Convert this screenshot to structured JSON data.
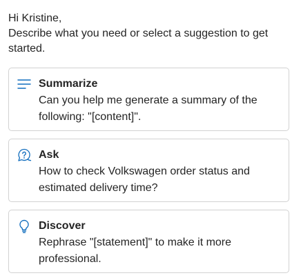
{
  "greeting": {
    "line1": "Hi Kristine,",
    "line2": "Describe what you need or select a suggestion to get started."
  },
  "suggestions": [
    {
      "icon": "text-lines-icon",
      "title": "Summarize",
      "description": "Can you help me generate a summary of the following: \"[content]\"."
    },
    {
      "icon": "chat-question-icon",
      "title": "Ask",
      "description": "How to check Volkswagen order status and estimated delivery time?"
    },
    {
      "icon": "lightbulb-icon",
      "title": "Discover",
      "description": "Rephrase \"[statement]\" to make it more professional."
    }
  ],
  "colors": {
    "accent": "#0f6cbd",
    "text": "#242424",
    "border": "#d1d1d1"
  }
}
